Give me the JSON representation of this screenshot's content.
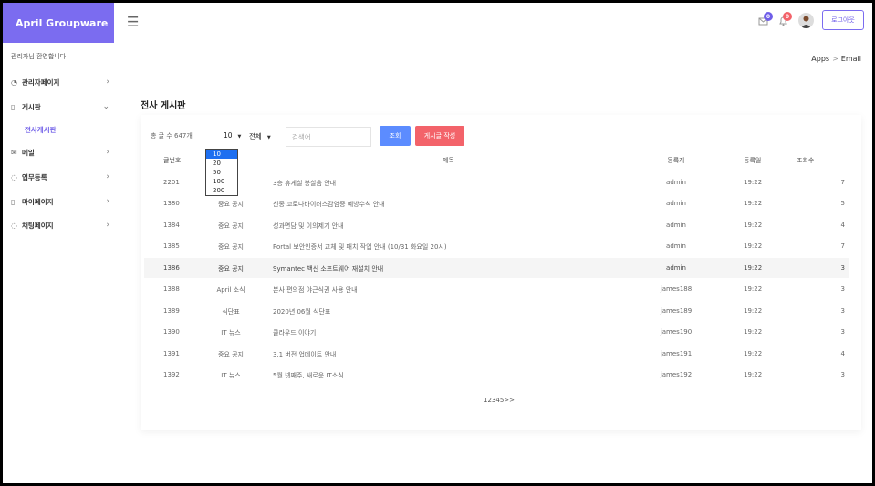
{
  "app": {
    "title": "April Groupware"
  },
  "sidebar": {
    "welcome": "관리자님 환영합니다",
    "items": [
      {
        "icon": "◔",
        "label": "관리자페이지",
        "chevron": "›"
      },
      {
        "icon": "▯",
        "label": "게시판",
        "chevron": "⌄"
      },
      {
        "icon": "✉",
        "label": "메일",
        "chevron": "›"
      },
      {
        "icon": "◌",
        "label": "업무등록",
        "chevron": "›"
      },
      {
        "icon": "▯",
        "label": "마이페이지",
        "chevron": "›"
      },
      {
        "icon": "◌",
        "label": "채팅페이지",
        "chevron": "›"
      }
    ],
    "active_sub": "전사게시판"
  },
  "header": {
    "menu_glyph": "☰",
    "badge_mail": "0",
    "badge_notify": "0",
    "logout_label": "로그아웃"
  },
  "breadcrumb": {
    "parent": "Apps",
    "separator": ">",
    "current": "Email"
  },
  "page": {
    "title": "전사 게시판"
  },
  "toolbar": {
    "total": "총 글 수 647개",
    "page_size": "10",
    "category": "전체",
    "select_arrow": "▼",
    "search_placeholder": "검색어",
    "search_button": "조회",
    "write_button": "게시글 작성"
  },
  "page_size_options": [
    "10",
    "20",
    "50",
    "100",
    "200"
  ],
  "table": {
    "headers": {
      "no": "글번호",
      "title": "제목",
      "author": "등록자",
      "date": "등록일",
      "views": "조회수"
    },
    "rows": [
      {
        "no": "2201",
        "category": "공지",
        "title": "3층 휴게실 붕살음 안내",
        "author": "admin",
        "date": "19:22",
        "views": "7"
      },
      {
        "no": "1380",
        "category": "중요 공지",
        "title": "신종 코로나바이러스감염증 예방수칙 안내",
        "author": "admin",
        "date": "19:22",
        "views": "5"
      },
      {
        "no": "1384",
        "category": "중요 공지",
        "title": "성과면담 및 이의제기 안내",
        "author": "admin",
        "date": "19:22",
        "views": "4"
      },
      {
        "no": "1385",
        "category": "중요 공지",
        "title": "Portal 보안인증서 교체 및 패치 작업 안내 (10/31 화요일 20시)",
        "author": "admin",
        "date": "19:22",
        "views": "7"
      },
      {
        "no": "1386",
        "category": "중요 공지",
        "title": "Symantec 백신 소프트웨어 재설치 안내",
        "author": "admin",
        "date": "19:22",
        "views": "3"
      },
      {
        "no": "1388",
        "category": "April 소식",
        "title": "본사 편의점 야근식권 사용 안내",
        "author": "james188",
        "date": "19:22",
        "views": "3"
      },
      {
        "no": "1389",
        "category": "식단표",
        "title": "2020년 06월 식단표",
        "author": "james189",
        "date": "19:22",
        "views": "3"
      },
      {
        "no": "1390",
        "category": "IT 뉴스",
        "title": "클라우드 이야기",
        "author": "james190",
        "date": "19:22",
        "views": "3"
      },
      {
        "no": "1391",
        "category": "중요 공지",
        "title": "3.1 버전 업데이트 안내",
        "author": "james191",
        "date": "19:22",
        "views": "4"
      },
      {
        "no": "1392",
        "category": "IT 뉴스",
        "title": "5월 넷째주, 새로운 IT소식",
        "author": "james192",
        "date": "19:22",
        "views": "3"
      }
    ]
  },
  "pagination": "12345>>",
  "colors": {
    "brand": "#7b6cf0",
    "search_button": "#5c8cff",
    "write_button": "#f3636a",
    "dropdown_selected": "#1e6ff0"
  }
}
